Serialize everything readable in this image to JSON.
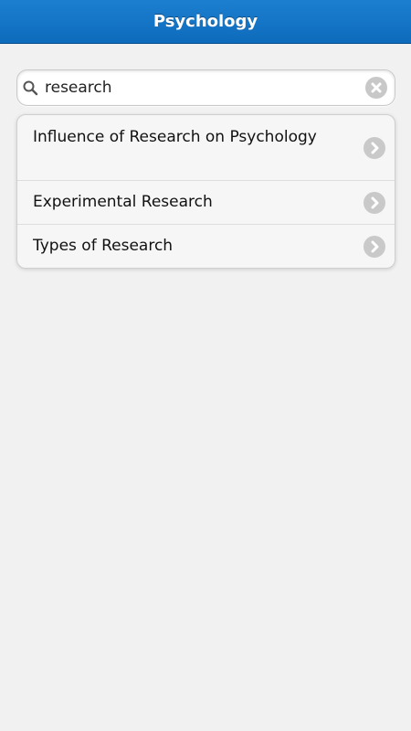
{
  "header": {
    "title": "Psychology"
  },
  "search": {
    "value": "research",
    "icon": "search-icon",
    "clear_icon": "clear-icon"
  },
  "results": {
    "items": [
      {
        "label": "Influence of Research on Psychology",
        "icon": "chevron-right-icon"
      },
      {
        "label": "Experimental Research",
        "icon": "chevron-right-icon"
      },
      {
        "label": "Types of Research",
        "icon": "chevron-right-icon"
      }
    ]
  },
  "colors": {
    "header_bg": "#1273c4",
    "page_bg": "#f1f1f1",
    "list_bg": "#f6f6f6",
    "icon_gray": "#c9c9c9"
  }
}
